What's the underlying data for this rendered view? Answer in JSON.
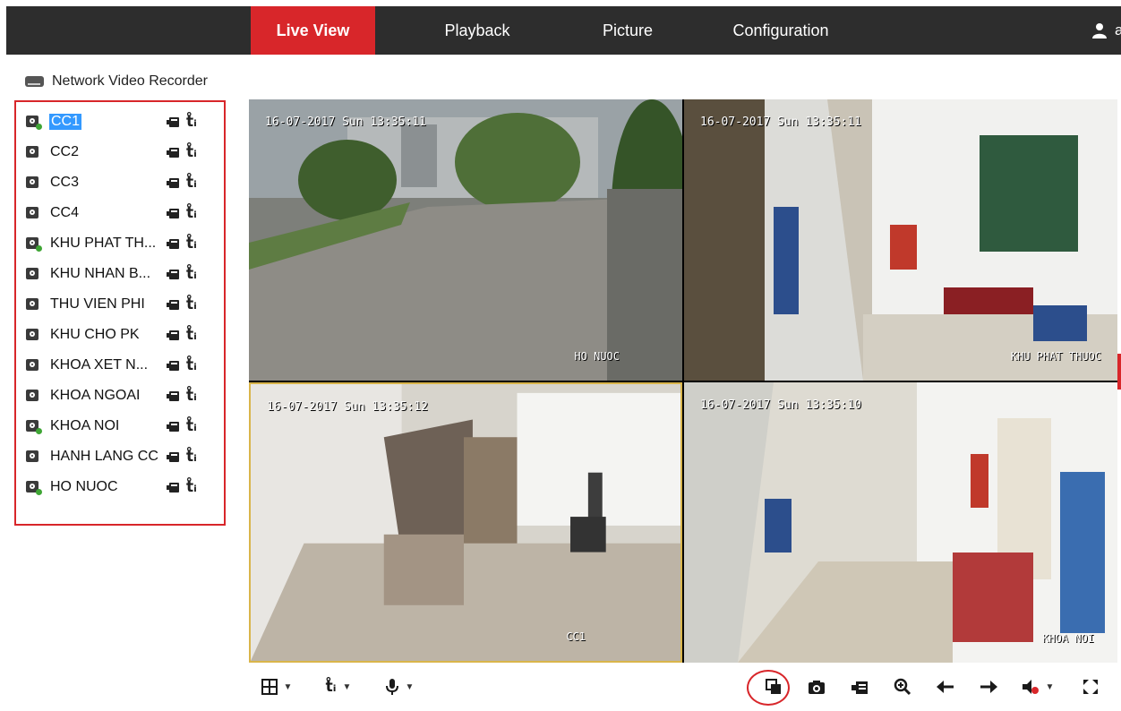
{
  "nav": {
    "tabs": [
      {
        "label": "Live View",
        "active": true
      },
      {
        "label": "Playback",
        "active": false
      },
      {
        "label": "Picture",
        "active": false
      },
      {
        "label": "Configuration",
        "active": false
      }
    ],
    "user_initial": "a",
    "user_icon": "user-icon"
  },
  "device": {
    "title": "Network Video Recorder",
    "icon": "nvr-icon"
  },
  "cameras": [
    {
      "name": "CC1",
      "recording_indicator": true,
      "selected": true
    },
    {
      "name": "CC2",
      "recording_indicator": false
    },
    {
      "name": "CC3",
      "recording_indicator": false
    },
    {
      "name": "CC4",
      "recording_indicator": false
    },
    {
      "name": "KHU PHAT TH...",
      "recording_indicator": true
    },
    {
      "name": "KHU NHAN B...",
      "recording_indicator": false
    },
    {
      "name": "THU VIEN PHI",
      "recording_indicator": false
    },
    {
      "name": "KHU CHO PK",
      "recording_indicator": false
    },
    {
      "name": "KHOA XET N...",
      "recording_indicator": false
    },
    {
      "name": "KHOA NGOAI",
      "recording_indicator": false
    },
    {
      "name": "KHOA NOI",
      "recording_indicator": true
    },
    {
      "name": "HANH LANG CC",
      "recording_indicator": false
    },
    {
      "name": "HO NUOC",
      "recording_indicator": true
    }
  ],
  "video_tiles": [
    {
      "timestamp": "16-07-2017 Sun 13:35:11",
      "channel_label": "HO NUOC"
    },
    {
      "timestamp": "16-07-2017 Sun 13:35:11",
      "channel_label": "KHU PHAT THUOC"
    },
    {
      "timestamp": "16-07-2017 Sun 13:35:12",
      "channel_label": "CC1",
      "selected": true
    },
    {
      "timestamp": "16-07-2017 Sun 13:35:10",
      "channel_label": "KHOA NOI"
    }
  ],
  "toolbar": {
    "left": [
      {
        "icon": "window-layout-icon",
        "has_dropdown": true
      },
      {
        "icon": "stream-type-icon",
        "has_dropdown": true
      },
      {
        "icon": "microphone-icon",
        "has_dropdown": true
      }
    ],
    "right": [
      {
        "icon": "start-all-live-view-icon",
        "highlighted": true
      },
      {
        "icon": "capture-icon"
      },
      {
        "icon": "record-icon"
      },
      {
        "icon": "digital-zoom-icon"
      },
      {
        "icon": "previous-page-icon"
      },
      {
        "icon": "next-page-icon"
      },
      {
        "icon": "audio-off-icon",
        "has_dropdown": true
      },
      {
        "icon": "fullscreen-icon"
      }
    ]
  },
  "colors": {
    "accent": "#d8262a",
    "topbar": "#2d2d2d",
    "selection": "#3399ff",
    "recording": "#3fa535",
    "tile_selected_border": "#d9b54a"
  }
}
